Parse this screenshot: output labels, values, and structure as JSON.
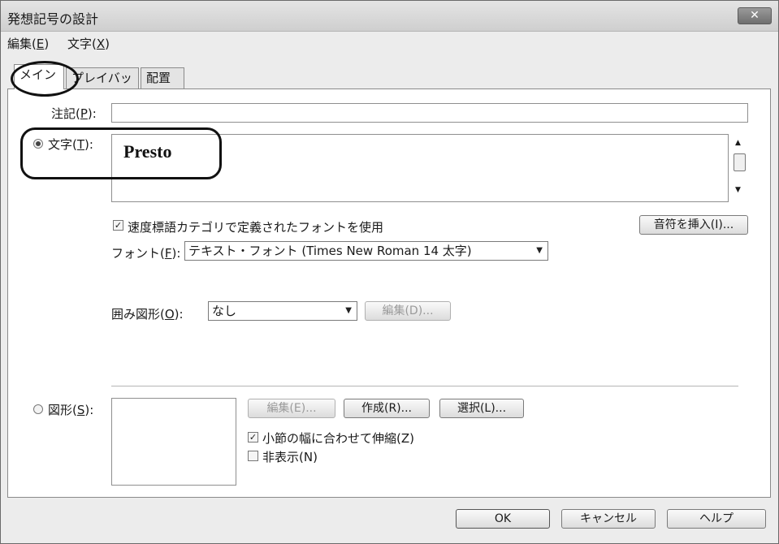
{
  "window": {
    "title": "発想記号の設計",
    "close_label": "✕"
  },
  "menu": [
    {
      "label": "編集(",
      "key": "E",
      "tail": ")"
    },
    {
      "label": "文字(",
      "key": "X",
      "tail": ")"
    }
  ],
  "tabs": [
    {
      "label": "メイン",
      "active": true
    },
    {
      "label": "プレイバック",
      "active": false
    },
    {
      "label": "配置",
      "active": false
    }
  ],
  "annotation": {
    "label": "注記(",
    "key": "P",
    "tail": "):",
    "value": ""
  },
  "text": {
    "radio_label": "文字(",
    "key": "T",
    "tail": "):",
    "value": "Presto",
    "use_category_font_label": "速度標語カテゴリで定義されたフォントを使用",
    "use_category_font_checked": true,
    "insert_note_button": "音符を挿入(I)..."
  },
  "font": {
    "label": "フォント(",
    "key": "F",
    "tail": "):",
    "value": "テキスト・フォント (Times New Roman 14 太字)"
  },
  "enclosure": {
    "label": "囲み図形(",
    "key": "O",
    "tail": "):",
    "value": "なし",
    "edit_button": "編集(D)..."
  },
  "shape": {
    "radio_label": "図形(",
    "key": "S",
    "tail": "):",
    "edit_button": "編集(E)...",
    "create_button": "作成(R)...",
    "select_button": "選択(L)...",
    "stretch_label": "小節の幅に合わせて伸縮(Z)",
    "stretch_checked": true,
    "hide_label": "非表示(N)",
    "hide_checked": false
  },
  "footer": {
    "ok": "OK",
    "cancel": "キャンセル",
    "help": "ヘルプ"
  }
}
